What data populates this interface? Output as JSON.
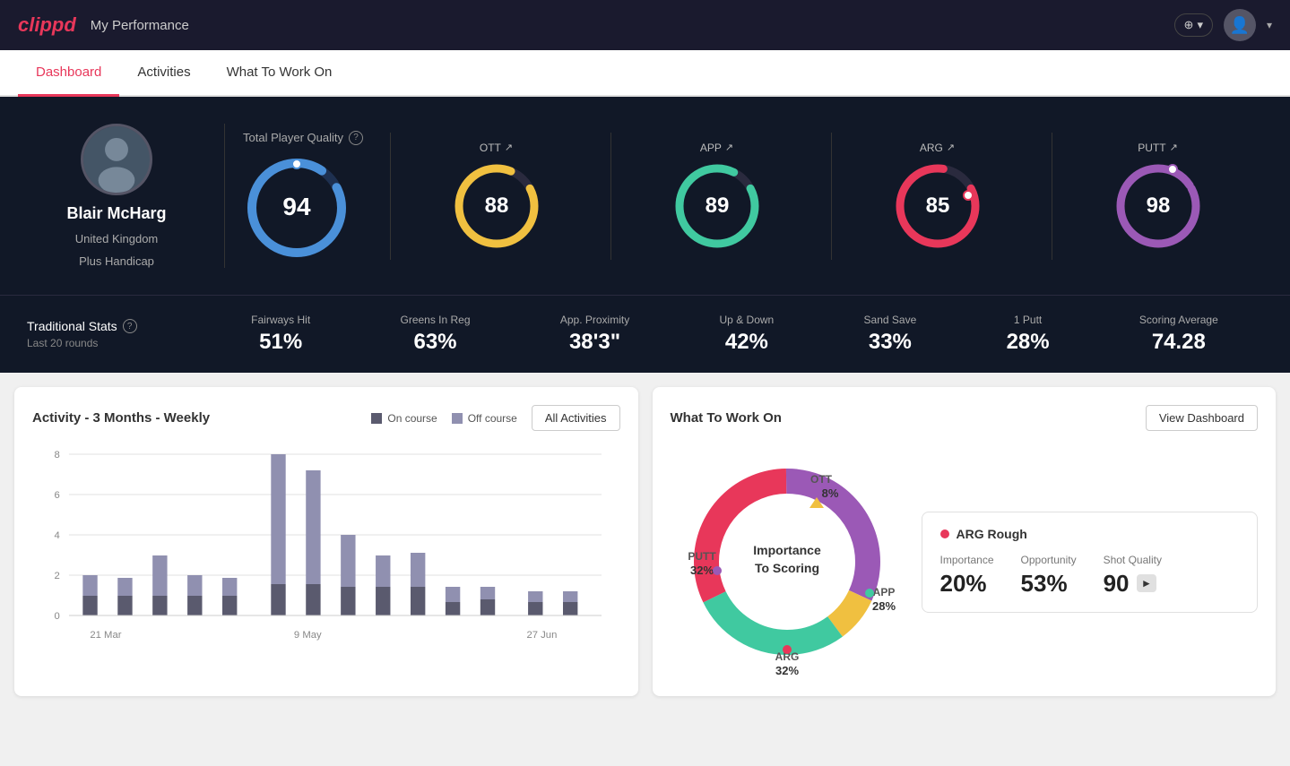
{
  "app": {
    "logo": "clippd",
    "header_title": "My Performance"
  },
  "nav": {
    "tabs": [
      {
        "id": "dashboard",
        "label": "Dashboard",
        "active": true
      },
      {
        "id": "activities",
        "label": "Activities",
        "active": false
      },
      {
        "id": "what-to-work-on",
        "label": "What To Work On",
        "active": false
      }
    ]
  },
  "player": {
    "name": "Blair McHarg",
    "country": "United Kingdom",
    "handicap": "Plus Handicap"
  },
  "total_player_quality": {
    "label": "Total Player Quality",
    "score": 94,
    "color": "#4a90d9"
  },
  "gauges": [
    {
      "id": "ott",
      "label": "OTT",
      "value": 88,
      "color": "#f0c040"
    },
    {
      "id": "app",
      "label": "APP",
      "value": 89,
      "color": "#40c9a0"
    },
    {
      "id": "arg",
      "label": "ARG",
      "value": 85,
      "color": "#e8375a"
    },
    {
      "id": "putt",
      "label": "PUTT",
      "value": 98,
      "color": "#9b59b6"
    }
  ],
  "traditional_stats": {
    "title": "Traditional Stats",
    "subtitle": "Last 20 rounds",
    "items": [
      {
        "label": "Fairways Hit",
        "value": "51%"
      },
      {
        "label": "Greens In Reg",
        "value": "63%"
      },
      {
        "label": "App. Proximity",
        "value": "38'3\""
      },
      {
        "label": "Up & Down",
        "value": "42%"
      },
      {
        "label": "Sand Save",
        "value": "33%"
      },
      {
        "label": "1 Putt",
        "value": "28%"
      },
      {
        "label": "Scoring Average",
        "value": "74.28"
      }
    ]
  },
  "activity_chart": {
    "title": "Activity - 3 Months - Weekly",
    "legend": {
      "on_course": "On course",
      "off_course": "Off course"
    },
    "all_activities_btn": "All Activities",
    "x_labels": [
      "21 Mar",
      "9 May",
      "27 Jun"
    ],
    "y_max": 8,
    "y_labels": [
      "0",
      "2",
      "4",
      "6",
      "8"
    ]
  },
  "what_to_work_on": {
    "title": "What To Work On",
    "view_dashboard_btn": "View Dashboard",
    "donut_center": "Importance\nTo Scoring",
    "segments": [
      {
        "label": "OTT",
        "value": "8%",
        "color": "#f0c040",
        "position": "top"
      },
      {
        "label": "APP",
        "value": "28%",
        "color": "#40c9a0",
        "position": "right"
      },
      {
        "label": "ARG",
        "value": "32%",
        "color": "#e8375a",
        "position": "bottom"
      },
      {
        "label": "PUTT",
        "value": "32%",
        "color": "#9b59b6",
        "position": "left"
      }
    ],
    "selected_item": {
      "title": "ARG Rough",
      "importance": "20%",
      "opportunity": "53%",
      "shot_quality": "90",
      "importance_label": "Importance",
      "opportunity_label": "Opportunity",
      "shot_quality_label": "Shot Quality"
    }
  },
  "header_buttons": {
    "add_label": "+",
    "profile_label": "▾"
  }
}
